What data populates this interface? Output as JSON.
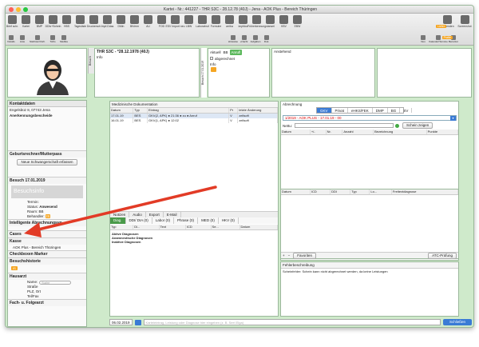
{
  "window": {
    "title": "Kartei - Nr.: 441227 - THR S3C - 28.12.78 (40J) - Jena - AOK Plus - Bereich Thüringen"
  },
  "toolbar": {
    "main": [
      {
        "label": "Brief schr.",
        "icon": "letter-icon"
      },
      {
        "label": "Kartei",
        "icon": "card-icon"
      },
      {
        "label": "BMP",
        "icon": "pill-icon"
      },
      {
        "label": "DDIs+Schein",
        "icon": "doc-icon"
      },
      {
        "label": "HBS",
        "icon": "doc-icon"
      },
      {
        "label": "Tagesliste",
        "icon": "list-icon"
      },
      {
        "label": "Druckersch",
        "icon": "print-icon"
      },
      {
        "label": "Impf-Ddas",
        "icon": "syringe-icon"
      },
      {
        "label": "DMin",
        "icon": "doc-icon"
      },
      {
        "label": "BtVerm",
        "icon": "doc-icon"
      },
      {
        "label": "AU",
        "icon": "doc-icon"
      },
      {
        "label": "FOD",
        "icon": "doc-icon"
      },
      {
        "label": "ESV Import neu",
        "icon": "import-icon"
      },
      {
        "label": "LBW",
        "icon": "doc-icon"
      },
      {
        "label": "Laborabruf",
        "icon": "flask-icon"
      },
      {
        "label": "Formulre",
        "icon": "form-icon"
      },
      {
        "label": "arriba",
        "icon": "arriba-icon"
      },
      {
        "label": "impfdoc",
        "icon": "impf-icon"
      },
      {
        "label": "Früherkennung",
        "icon": "search-icon"
      },
      {
        "label": "starwel",
        "icon": "star-icon"
      },
      {
        "label": "KBV",
        "icon": "kbv-icon"
      },
      {
        "label": "EBW",
        "icon": "ebw-icon"
      }
    ],
    "right": [
      {
        "label": "GD senden",
        "icon": "speaker-icon"
      },
      {
        "label": "Screenshot",
        "icon": "camera-icon"
      }
    ],
    "row2": [
      {
        "label": "Details"
      },
      {
        "label": "Liste"
      },
      {
        "label": "Nächster/Vorh."
      },
      {
        "label": "ToDo"
      },
      {
        "label": "Medika"
      }
    ],
    "row2_center": [
      {
        "label": "Hinweise"
      },
      {
        "label": "+Nachr."
      },
      {
        "label": "Aufgaben"
      },
      {
        "label": "Dok."
      }
    ],
    "row2_right": [
      {
        "label": "Neu"
      },
      {
        "label": "Kalender/Termine"
      },
      {
        "label": "Benutzer"
      }
    ],
    "status_orange": "Liefer",
    "status_orange2": "Pratte"
  },
  "patient": {
    "name_line": "THR S3C - *28.12.1978 (40J)",
    "info_label": "Info",
    "aktuell_label": "Aktuell",
    "aktuell_value": "BB",
    "aktuell_badge": "Anrufl",
    "abgerechnet_label": "abgerechnet",
    "info2_label": "Info",
    "anstehend_label": "Anstehend",
    "side_tab_1": "Besuch",
    "side_tab_2": "Besuch 17.01.2019"
  },
  "left": {
    "kontaktdaten_title": "Kontaktdaten",
    "address": "Engelsbüz 8, 07743 Jena",
    "anerkennung": "Anerkennungsbescheide",
    "geburt_title": "Geburtsrechner/Mutterpass",
    "neue_schw": "Neue Schwangerschaft erfassen",
    "besuch_title": "Besuch 17.01.2019",
    "besuchsinfo": "Besuchsinfo",
    "termin_label": "Termin:",
    "status_label": "Status:",
    "status_value": "Anwesend",
    "raum_label": "Raum:",
    "raum_value": "BB",
    "behandler_label": "Behandler:",
    "behandler_value": "IS",
    "iav_title": "Intelligente Abrechnungsvo...",
    "cases": "Cases",
    "kasse_title": "Kasse",
    "kasse_value": "AOK Plus - Bereich Thüringen",
    "checkboxen": "Checkboxen Marker",
    "besuchshistorie": "Besuchshistorie",
    "hist_badge": "IS",
    "hausarzt_title": "Hausarzt",
    "name_label": "Name:",
    "search_placeholder": "Suche",
    "strasse_label": "Straße",
    "plz_label": "PLZ, Ort",
    "tel_label": "Tel/Fax",
    "fach_title": "Fach- u. Folgearzt"
  },
  "meddok": {
    "title": "Medizinische Dokumentation",
    "columns": [
      "Datum",
      "Typ",
      "Eintrag",
      "Pr",
      "letzte Änderung"
    ],
    "rows": [
      {
        "date": "17.01.19",
        "typ": "BES",
        "entry": "GKV(2, APK) ● 21:36 ● zu ● Anruf",
        "pr": "V",
        "last": "zellsoft"
      },
      {
        "date": "16.01.19",
        "typ": "BES",
        "entry": "GKV(1, APK) ● 12:02",
        "pr": "V",
        "last": "zellsoft"
      }
    ],
    "bottom_tabs": [
      "Notizen",
      "Audio",
      "Export",
      "E-Mail"
    ],
    "sub_tabs": [
      "Diag.",
      "DDI/ DIA (0)",
      "Labor (0)",
      "Phrase (0)",
      "MED (0)",
      "HKV (0)"
    ],
    "diag_columns": [
      "Typ",
      "Di...",
      "Text",
      "ICD",
      "Se...",
      "Datum"
    ],
    "diag_rows": [
      "Aktive Diagnosen",
      "Anamnestische Diagnosen",
      "Inaktive Diagnosen"
    ]
  },
  "abrechnung": {
    "title": "Abrechnung",
    "tabs": [
      "GKV (1)",
      "Privat",
      "eHKS/FEK",
      "DMP",
      "BG",
      "SV"
    ],
    "case_line": "1/2019 - AOK PLUS - 17.01.19 - 00",
    "nettu_label": "Nettu:",
    "schein_btn": "Schein zeigen",
    "columns": [
      "Datum",
      "+/-",
      "Nr.",
      "Anzahl",
      "Bezeichnung",
      "Punkte"
    ],
    "favoriten": "Favoriten",
    "sachkosten": "Sachkosten",
    "nichtops": "nicht OPS",
    "summe": "Summe: + 0 Pkt",
    "diag_columns": [
      "Datum",
      "ICD",
      "DDI",
      "Typ",
      "Lo...",
      "Freitextdiagnose"
    ],
    "favoriten2": "Favoriten",
    "atc": "ATC-Prüfung",
    "fehler_title": "Fehlerbeschreibung",
    "fehler_text": "Scheinfehler: Schein kann nicht abgerechnet werden, da keine Leistungen"
  },
  "footer": {
    "date": "06.02.2019",
    "input_placeholder": "Karteieintrag, Leistung oder Diagnose hier eingeben (z. B. Seel Elga)",
    "schliessen": "Schließen"
  }
}
